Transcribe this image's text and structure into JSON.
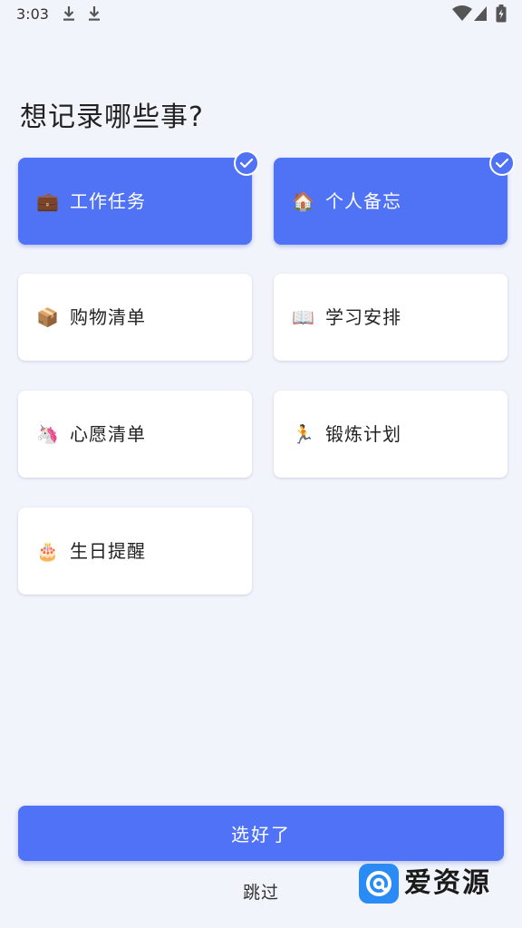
{
  "status_bar": {
    "time": "3:03",
    "icons": [
      "download-icon",
      "download-icon",
      "wifi-icon",
      "signal-icon",
      "battery-charging-icon"
    ]
  },
  "title": "想记录哪些事?",
  "options": [
    {
      "emoji": "💼",
      "label": "工作任务",
      "selected": true
    },
    {
      "emoji": "🏠",
      "label": "个人备忘",
      "selected": true
    },
    {
      "emoji": "📦",
      "label": "购物清单",
      "selected": false
    },
    {
      "emoji": "📖",
      "label": "学习安排",
      "selected": false
    },
    {
      "emoji": "🦄",
      "label": "心愿清单",
      "selected": false
    },
    {
      "emoji": "🏃",
      "label": "锻炼计划",
      "selected": false
    },
    {
      "emoji": "🎂",
      "label": "生日提醒",
      "selected": false
    }
  ],
  "confirm_button": "选好了",
  "skip_label": "跳过",
  "watermark": {
    "text": "爱资源"
  },
  "colors": {
    "accent": "#5073f6",
    "background": "#f2f4fc",
    "card": "#ffffff",
    "watermark_blue": "#2b8bf4"
  }
}
